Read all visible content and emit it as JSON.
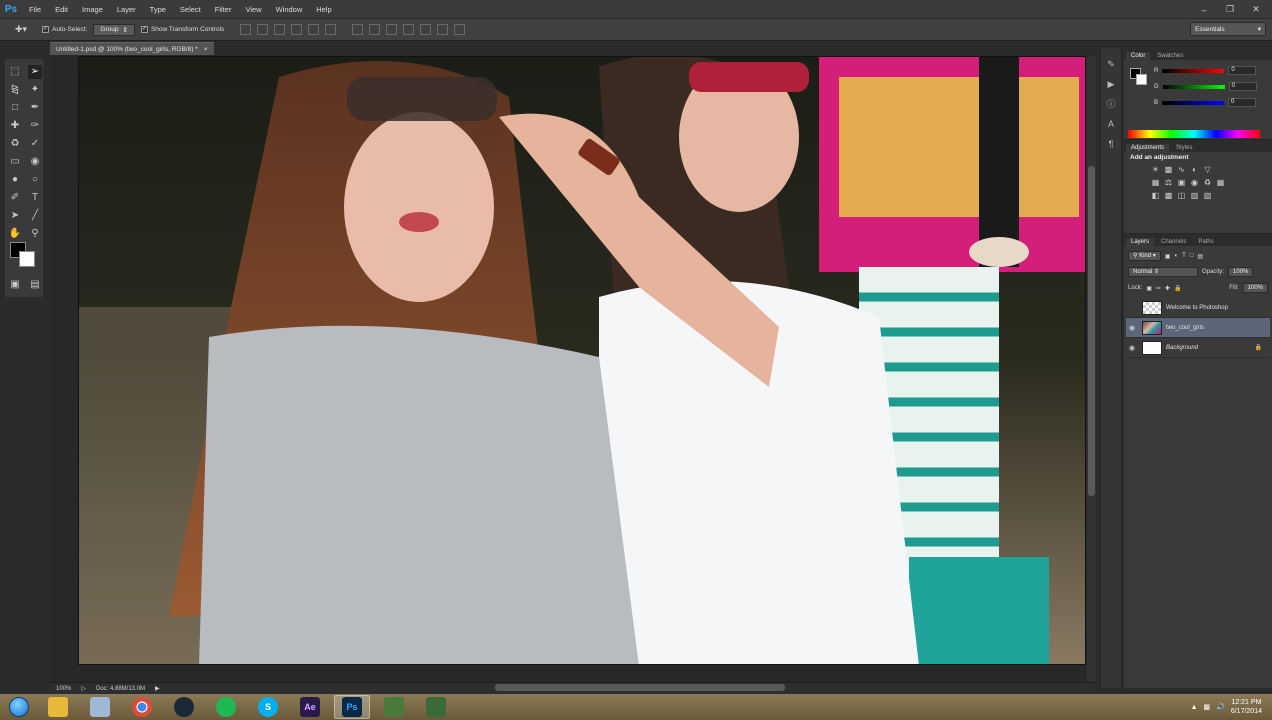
{
  "app": {
    "logo": "Ps"
  },
  "menu": [
    "File",
    "Edit",
    "Image",
    "Layer",
    "Type",
    "Select",
    "Filter",
    "View",
    "Window",
    "Help"
  ],
  "window_controls": [
    "minimize",
    "restore",
    "close"
  ],
  "options_bar": {
    "auto_select_label": "Auto-Select:",
    "auto_select_value": "Group",
    "show_transform_label": "Show Transform Controls",
    "workspace": "Essentials"
  },
  "document_tab": {
    "title": "Untitled-1.psd @ 100% (two_cool_girls, RGB/8) *",
    "close": "×"
  },
  "status_bar": {
    "zoom": "100%",
    "doc_info": "Doc: 4.88M/13.0M"
  },
  "panels": {
    "color_tabs": [
      "Color",
      "Swatches"
    ],
    "sliders": [
      {
        "label": "R",
        "value": "0",
        "color": "#ff3b3b"
      },
      {
        "label": "G",
        "value": "0",
        "color": "#3bd13b"
      },
      {
        "label": "B",
        "value": "0",
        "color": "#3b6bff"
      }
    ],
    "adjustment_tabs": [
      "Adjustments",
      "Styles"
    ],
    "adjustment_title": "Add an adjustment",
    "layers_tabs": [
      "Layers",
      "Channels",
      "Paths"
    ],
    "kind_label": "Kind",
    "blend_mode": "Normal",
    "opacity_label": "Opacity:",
    "opacity_value": "100%",
    "lock_label": "Lock:",
    "fill_label": "Fill:",
    "fill_value": "100%",
    "layers": [
      {
        "name": "Welcome to Photoshop",
        "visible": false,
        "selected": false,
        "thumb": "trans"
      },
      {
        "name": "two_cool_girls",
        "visible": true,
        "selected": true,
        "thumb": "img"
      },
      {
        "name": "Background",
        "visible": true,
        "selected": false,
        "thumb": "white",
        "locked": true
      }
    ]
  },
  "taskbar": {
    "apps": [
      {
        "name": "explorer",
        "label": "",
        "color": "#e8b83a"
      },
      {
        "name": "notepad",
        "label": "",
        "color": "#9fb8d8"
      },
      {
        "name": "chrome",
        "label": "",
        "color": "#dd4b39"
      },
      {
        "name": "steam",
        "label": "",
        "color": "#1b2838"
      },
      {
        "name": "spotify",
        "label": "",
        "color": "#1db954"
      },
      {
        "name": "skype",
        "label": "S",
        "color": "#00aff0"
      },
      {
        "name": "after-effects",
        "label": "Ae",
        "color": "#2a1a4a"
      },
      {
        "name": "photoshop",
        "label": "Ps",
        "color": "#0b2a4a"
      },
      {
        "name": "app-green",
        "label": "",
        "color": "#4a7a3a"
      },
      {
        "name": "app-cards",
        "label": "",
        "color": "#3a6a3a"
      }
    ],
    "clock": {
      "time": "12:21 PM",
      "date": "6/17/2014"
    }
  }
}
